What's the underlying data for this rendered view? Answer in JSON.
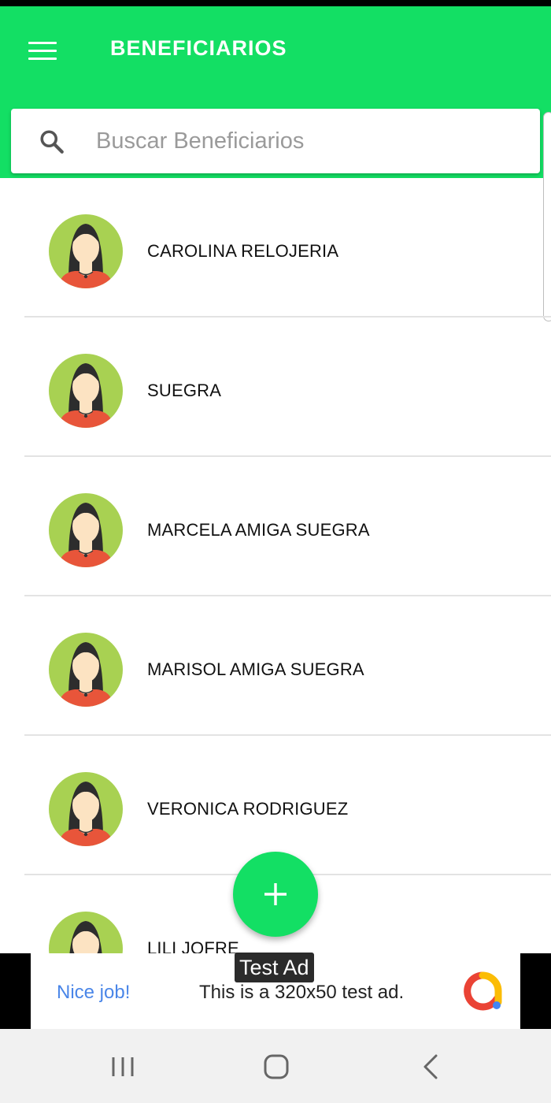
{
  "app_bar": {
    "title": "BENEFICIARIOS",
    "background_color": "#13DF64",
    "menu_icon": "hamburger-menu-icon"
  },
  "search": {
    "placeholder": "Buscar Beneficiarios",
    "value": "",
    "icon": "search-icon"
  },
  "beneficiaries": [
    {
      "name": "CAROLINA RELOJERIA",
      "avatar": "female-avatar-icon"
    },
    {
      "name": "SUEGRA",
      "avatar": "female-avatar-icon"
    },
    {
      "name": "MARCELA AMIGA SUEGRA",
      "avatar": "female-avatar-icon"
    },
    {
      "name": "MARISOL AMIGA SUEGRA",
      "avatar": "female-avatar-icon"
    },
    {
      "name": "VERONICA RODRIGUEZ",
      "avatar": "female-avatar-icon"
    },
    {
      "name": "LILI JOFRE",
      "avatar": "female-avatar-icon"
    }
  ],
  "fab": {
    "icon": "plus-icon",
    "color": "#13DF64"
  },
  "ad": {
    "tag": "Test Ad",
    "headline": "Nice job!",
    "body": "This is a 320x50 test ad.",
    "logo": "ad-choices-logo-icon"
  },
  "nav_bar": {
    "buttons": [
      "recent-apps-icon",
      "home-icon",
      "back-icon"
    ]
  }
}
